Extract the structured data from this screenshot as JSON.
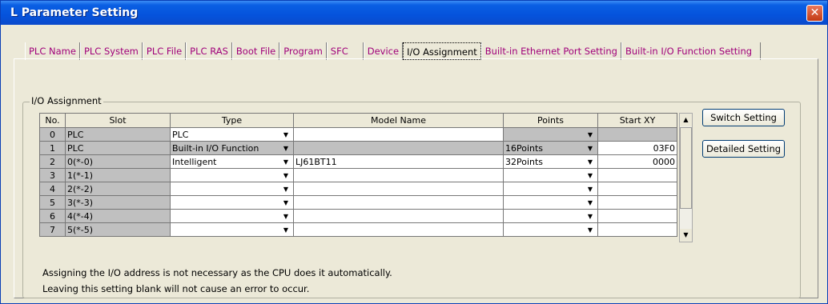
{
  "window": {
    "title": "L Parameter Setting",
    "close_glyph": "✕"
  },
  "tabs": [
    {
      "label": "PLC Name"
    },
    {
      "label": "PLC System"
    },
    {
      "label": "PLC File"
    },
    {
      "label": "PLC RAS"
    },
    {
      "label": "Boot File"
    },
    {
      "label": "Program"
    },
    {
      "label": "SFC"
    },
    {
      "label": "Device"
    },
    {
      "label": "I/O Assignment"
    },
    {
      "label": "Built-in Ethernet Port Setting"
    },
    {
      "label": "Built-in I/O Function Setting"
    }
  ],
  "group_label": "I/O Assignment",
  "table": {
    "headers": {
      "no": "No.",
      "slot": "Slot",
      "type": "Type",
      "model": "Model Name",
      "points": "Points",
      "start": "Start XY"
    },
    "rows": [
      {
        "no": "0",
        "slot": "PLC",
        "type": "PLC",
        "model": "",
        "points": "",
        "start": ""
      },
      {
        "no": "1",
        "slot": "PLC",
        "type": "Built-in I/O Function",
        "model": "",
        "points": "16Points",
        "start": "03F0"
      },
      {
        "no": "2",
        "slot": "0(*-0)",
        "type": "Intelligent",
        "model": "LJ61BT11",
        "points": "32Points",
        "start": "0000"
      },
      {
        "no": "3",
        "slot": "1(*-1)",
        "type": "",
        "model": "",
        "points": "",
        "start": ""
      },
      {
        "no": "4",
        "slot": "2(*-2)",
        "type": "",
        "model": "",
        "points": "",
        "start": ""
      },
      {
        "no": "5",
        "slot": "3(*-3)",
        "type": "",
        "model": "",
        "points": "",
        "start": ""
      },
      {
        "no": "6",
        "slot": "4(*-4)",
        "type": "",
        "model": "",
        "points": "",
        "start": ""
      },
      {
        "no": "7",
        "slot": "5(*-5)",
        "type": "",
        "model": "",
        "points": "",
        "start": ""
      }
    ]
  },
  "buttons": {
    "switch_setting": "Switch Setting",
    "detailed_setting": "Detailed Setting"
  },
  "notes": [
    "Assigning the I/O address is not necessary as the CPU does it automatically.",
    "Leaving this setting blank will not cause an error to occur."
  ],
  "colors": {
    "title_bar": "#0553dc",
    "tab_text": "#a0007a",
    "dialog_bg": "#ece9d8",
    "readonly_cell": "#c0c0c0"
  }
}
